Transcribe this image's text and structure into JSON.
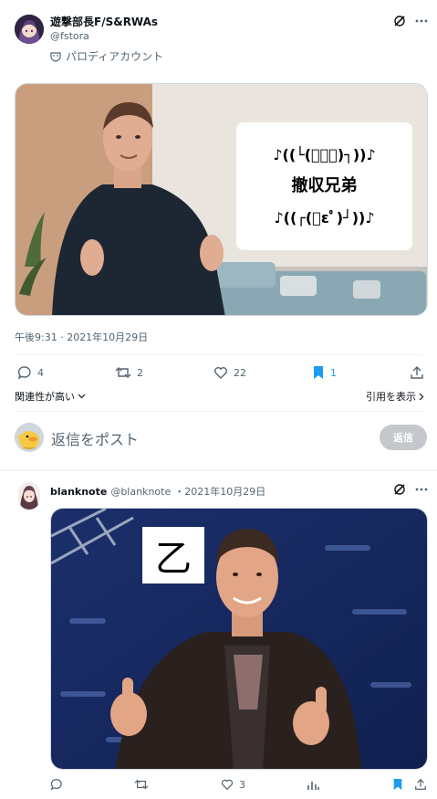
{
  "main_post": {
    "display_name": "遊撃部長F/S&RWAs",
    "handle": "@fstora",
    "parody_label": "パロディアカウント",
    "caption_lines": [
      "♪((└(ﾟ３ﾟ)┐))♪",
      "撤収兄弟",
      "♪((┌(ﾟεﾟ)┘))♪"
    ],
    "timestamp": "午後9:31 · 2021年10月29日",
    "stats": {
      "replies": "4",
      "reposts": "2",
      "likes": "22",
      "bookmarks": "1"
    },
    "sort_label": "関連性が高い",
    "quote_link": "引用を表示"
  },
  "reply_box": {
    "placeholder": "返信をポスト",
    "button_label": "返信"
  },
  "reply_post": {
    "display_name": "blanknote",
    "handle": "@blanknote",
    "date": "・2021年10月29日",
    "overlay_char": "乙",
    "stats": {
      "likes": "3"
    }
  },
  "colors": {
    "accent": "#1d9bf0",
    "muted": "#536471",
    "divider": "#eff3f4",
    "reply_button_bg": "#c4c8cc"
  }
}
